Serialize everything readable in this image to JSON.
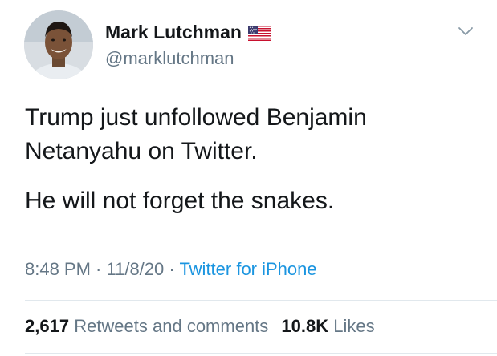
{
  "user": {
    "display_name": "Mark Lutchman",
    "handle": "@marklutchman",
    "flag_icon": "us-flag-icon",
    "avatar_icon": "profile-photo"
  },
  "tweet": {
    "paragraphs": [
      "Trump just unfollowed Benjamin Netanyahu on Twitter.",
      "He will not forget the snakes."
    ]
  },
  "meta": {
    "time": "8:48 PM",
    "separator": " · ",
    "date": "11/8/20",
    "separator2": " · ",
    "source": "Twitter for iPhone"
  },
  "stats": {
    "retweets_count": "2,617",
    "retweets_label": "Retweets and comments",
    "likes_count": "10.8K",
    "likes_label": "Likes"
  },
  "colors": {
    "text_primary": "#14171a",
    "text_secondary": "#657786",
    "link": "#1b95e0",
    "divider": "#e1e8ed"
  }
}
